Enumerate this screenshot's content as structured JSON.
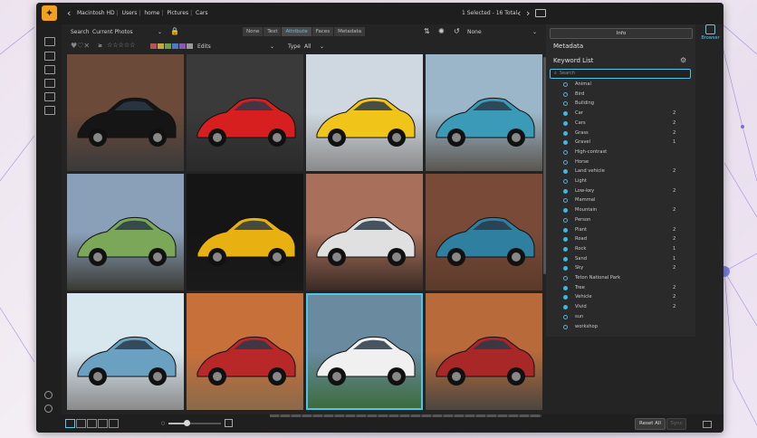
{
  "window": {
    "breadcrumb": [
      "Macintosh HD",
      "Users",
      "home",
      "Pictures",
      "Cars"
    ],
    "selection_count": "1 Selected - 16 Total"
  },
  "toolbar": {
    "search_label": "Search",
    "search_scope": "Current Photos",
    "tabs": [
      "None",
      "Text",
      "Attribute",
      "Faces",
      "Metadata"
    ],
    "active_tab": "Attribute",
    "edits_label": "Edits",
    "type_label": "Type",
    "type_value": "All",
    "sort_value": "None",
    "color_labels": [
      "#b85450",
      "#c9a640",
      "#6aa050",
      "#4a7ac0",
      "#8a5ab0",
      "#9a9a9a"
    ]
  },
  "photos": [
    {
      "name": "black-porsche-classic",
      "car": "#151515",
      "sky": "#6b4a3a",
      "ground": "#3a3a3a"
    },
    {
      "name": "red-porsche-gt3",
      "car": "#d81f1f",
      "sky": "#3a3a3a",
      "ground": "#2a2a2a"
    },
    {
      "name": "yellow-supra",
      "car": "#f0c419",
      "sky": "#cfd8e0",
      "ground": "#8a8a8a"
    },
    {
      "name": "blue-rx7",
      "car": "#3a9ab8",
      "sky": "#9bb6c8",
      "ground": "#5a5650"
    },
    {
      "name": "green-porsche-356",
      "car": "#7aa858",
      "sky": "#8aa0b8",
      "ground": "#3a3a34"
    },
    {
      "name": "yellow-porsche-911",
      "car": "#e8b010",
      "sky": "#151515",
      "ground": "#1a1a1a"
    },
    {
      "name": "white-sportscar-sunset",
      "car": "#e0e0e0",
      "sky": "#a8705a",
      "ground": "#3a2a26"
    },
    {
      "name": "blue-alpine",
      "car": "#2f7fa0",
      "sky": "#7a4a38",
      "ground": "#5a3a2a"
    },
    {
      "name": "blue-classic-lightroom",
      "car": "#6aa0c0",
      "sky": "#d8e6ee",
      "ground": "#8a8a8a"
    },
    {
      "name": "red-vintage-sedan",
      "car": "#b82828",
      "sky": "#c8703a",
      "ground": "#8a6a4a"
    },
    {
      "name": "white-porsche-mountains",
      "car": "#f0f0f0",
      "sky": "#6a8aa0",
      "ground": "#3a6a3a"
    },
    {
      "name": "red-subaru-forester",
      "car": "#a82828",
      "sky": "#b86a3a",
      "ground": "#4a4640"
    }
  ],
  "selected_photo": 10,
  "metadata": {
    "info_button": "Info",
    "title": "Metadata",
    "keyword_title": "Keyword List",
    "search_placeholder": "Search",
    "keywords": [
      {
        "name": "Animal",
        "count": "",
        "on": false
      },
      {
        "name": "Bird",
        "count": "",
        "on": false
      },
      {
        "name": "Building",
        "count": "",
        "on": false
      },
      {
        "name": "Car",
        "count": "2",
        "on": true
      },
      {
        "name": "Cars",
        "count": "2",
        "on": true
      },
      {
        "name": "Grass",
        "count": "2",
        "on": true
      },
      {
        "name": "Gravel",
        "count": "1",
        "on": true
      },
      {
        "name": "High-contrast",
        "count": "",
        "on": false
      },
      {
        "name": "Horse",
        "count": "",
        "on": false
      },
      {
        "name": "Land vehicle",
        "count": "2",
        "on": true
      },
      {
        "name": "Light",
        "count": "",
        "on": false
      },
      {
        "name": "Low-key",
        "count": "2",
        "on": true
      },
      {
        "name": "Mammal",
        "count": "",
        "on": false
      },
      {
        "name": "Mountain",
        "count": "2",
        "on": true
      },
      {
        "name": "Person",
        "count": "",
        "on": false
      },
      {
        "name": "Plant",
        "count": "2",
        "on": true
      },
      {
        "name": "Road",
        "count": "2",
        "on": true
      },
      {
        "name": "Rock",
        "count": "1",
        "on": true
      },
      {
        "name": "Sand",
        "count": "1",
        "on": true
      },
      {
        "name": "Sky",
        "count": "2",
        "on": true
      },
      {
        "name": "Teton National Park",
        "count": "",
        "on": false
      },
      {
        "name": "Tree",
        "count": "2",
        "on": true
      },
      {
        "name": "Vehicle",
        "count": "2",
        "on": true
      },
      {
        "name": "Vivid",
        "count": "2",
        "on": true
      },
      {
        "name": "sun",
        "count": "",
        "on": false
      },
      {
        "name": "workshop",
        "count": "",
        "on": false
      }
    ]
  },
  "sidebar_right": {
    "browser_label": "Browser"
  },
  "bottom": {
    "reset_all": "Reset All",
    "sync": "Sync",
    "zoom": 0.35
  }
}
